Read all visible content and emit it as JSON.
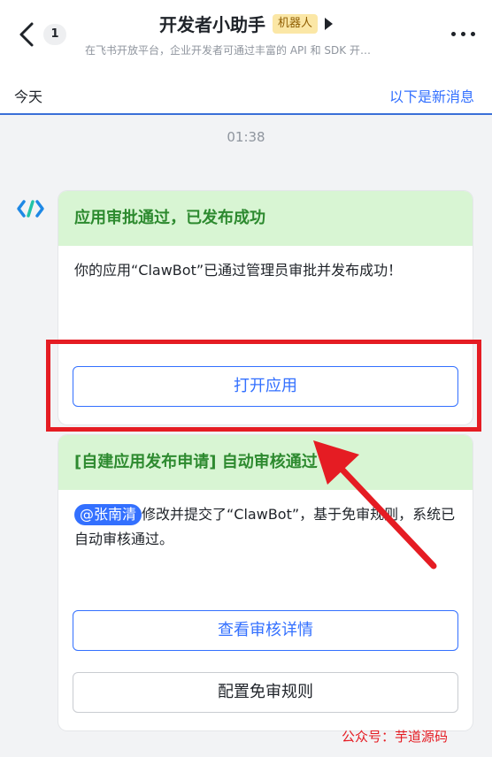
{
  "header": {
    "unread_count": "1",
    "title": "开发者小助手",
    "bot_badge": "机器人",
    "subtitle": "在飞书开放平台，企业开发者可通过丰富的 API 和 SDK 开…"
  },
  "today_bar": {
    "today_label": "今天",
    "new_messages_link": "以下是新消息"
  },
  "timestamp": "01:38",
  "card_approved": {
    "title": "应用审批通过，已发布成功",
    "body": "你的应用“ClawBot”已通过管理员审批并发布成功！",
    "open_app_label": "打开应用"
  },
  "card_auto_review": {
    "title": "[自建应用发布申请] 自动审核通过",
    "mention": "@张南清",
    "body": "修改并提交了“ClawBot”，基于免审规则，系统已自动审核通过。",
    "view_details_label": "查看审核详情",
    "configure_rules_label": "配置免审规则"
  },
  "watermark": "公众号：芋道源码",
  "colors": {
    "accent_blue": "#3370ff",
    "card_header_green": "#d8f5d3",
    "highlight_red": "#e51c23"
  }
}
